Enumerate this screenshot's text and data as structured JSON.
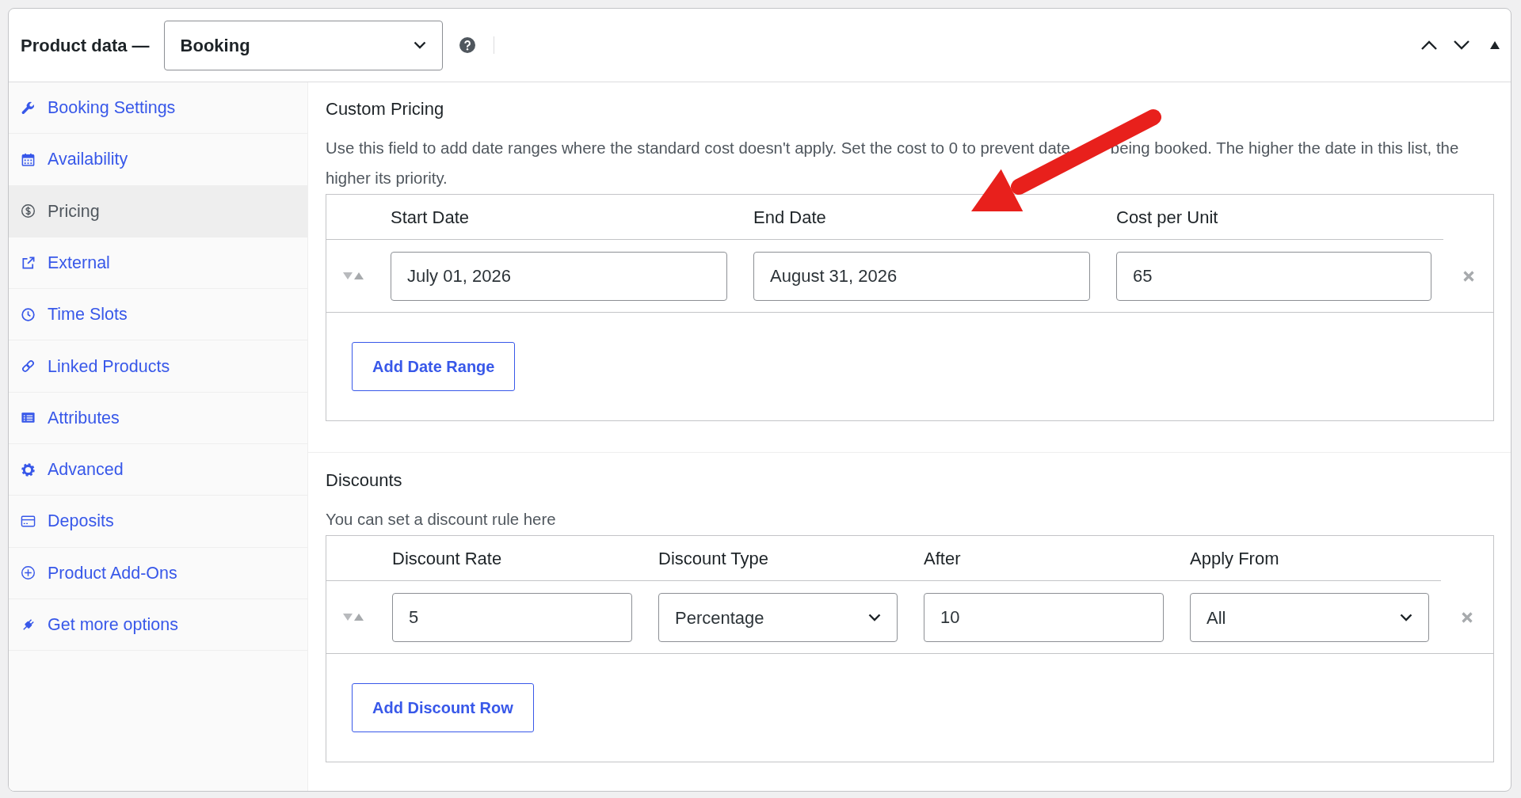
{
  "panel": {
    "title": "Product data —",
    "product_type": "Booking"
  },
  "sidebar": {
    "items": [
      {
        "label": "Booking Settings",
        "selected": false
      },
      {
        "label": "Availability",
        "selected": false
      },
      {
        "label": "Pricing",
        "selected": true
      },
      {
        "label": "External",
        "selected": false
      },
      {
        "label": "Time Slots",
        "selected": false
      },
      {
        "label": "Linked Products",
        "selected": false
      },
      {
        "label": "Attributes",
        "selected": false
      },
      {
        "label": "Advanced",
        "selected": false
      },
      {
        "label": "Deposits",
        "selected": false
      },
      {
        "label": "Product Add-Ons",
        "selected": false
      },
      {
        "label": "Get more options",
        "selected": false
      }
    ]
  },
  "sections": [
    {
      "title": "Custom Pricing",
      "description_parts": [
        "Use this field to add date ranges where the standard cost doesn't apply. Set the cost to 0 to prevent date",
        "being booked. The higher the date in this list, the",
        "higher its priority."
      ],
      "annotation": {
        "kind": "arrow"
      },
      "columns": [
        "Start Date",
        "End Date",
        "Cost per Unit"
      ],
      "rows": [
        {
          "cells": [
            {
              "kind": "input",
              "value": "July 01, 2026"
            },
            {
              "kind": "input",
              "value": "August 31, 2026"
            },
            {
              "kind": "input",
              "value": "65"
            }
          ]
        }
      ],
      "add_button": "Add Date Range"
    },
    {
      "title": "Discounts",
      "description_parts": [
        "You can set a discount rule here"
      ],
      "columns": [
        "Discount Rate",
        "Discount Type",
        "After",
        "Apply From"
      ],
      "rows": [
        {
          "cells": [
            {
              "kind": "input",
              "value": "5"
            },
            {
              "kind": "select",
              "value": "Percentage"
            },
            {
              "kind": "input",
              "value": "10"
            },
            {
              "kind": "select",
              "value": "All"
            }
          ]
        }
      ],
      "add_button": "Add Discount Row"
    }
  ]
}
